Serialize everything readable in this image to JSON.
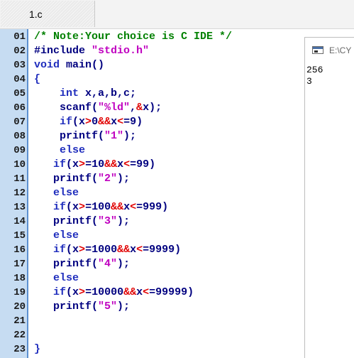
{
  "tabs": [
    {
      "label": "1.c"
    }
  ],
  "editor": {
    "lines": [
      {
        "n": "01",
        "tokens": [
          {
            "t": "/* Note:Your choice is C IDE */",
            "c": "comment"
          }
        ]
      },
      {
        "n": "02",
        "tokens": [
          {
            "t": "#include ",
            "c": "pre"
          },
          {
            "t": "\"stdio.h\"",
            "c": "str"
          }
        ]
      },
      {
        "n": "03",
        "tokens": [
          {
            "t": "void",
            "c": "kw"
          },
          {
            "t": " main()",
            "c": "plain"
          }
        ]
      },
      {
        "n": "04",
        "tokens": [
          {
            "t": "{",
            "c": "brace"
          }
        ]
      },
      {
        "n": "05",
        "tokens": [
          {
            "t": "    ",
            "c": "plain"
          },
          {
            "t": "int",
            "c": "kw"
          },
          {
            "t": " x,a,b,c;",
            "c": "plain"
          }
        ]
      },
      {
        "n": "06",
        "tokens": [
          {
            "t": "    scanf(",
            "c": "plain"
          },
          {
            "t": "\"%ld\"",
            "c": "str"
          },
          {
            "t": ",",
            "c": "plain"
          },
          {
            "t": "&",
            "c": "op"
          },
          {
            "t": "x);",
            "c": "plain"
          }
        ]
      },
      {
        "n": "07",
        "tokens": [
          {
            "t": "    ",
            "c": "plain"
          },
          {
            "t": "if",
            "c": "kw"
          },
          {
            "t": "(x",
            "c": "plain"
          },
          {
            "t": ">",
            "c": "op"
          },
          {
            "t": "0",
            "c": "plain"
          },
          {
            "t": "&&",
            "c": "op"
          },
          {
            "t": "x",
            "c": "plain"
          },
          {
            "t": "<",
            "c": "op"
          },
          {
            "t": "=9)",
            "c": "plain"
          }
        ]
      },
      {
        "n": "08",
        "tokens": [
          {
            "t": "    printf(",
            "c": "plain"
          },
          {
            "t": "\"1\"",
            "c": "str"
          },
          {
            "t": ");",
            "c": "plain"
          }
        ]
      },
      {
        "n": "09",
        "tokens": [
          {
            "t": "    ",
            "c": "plain"
          },
          {
            "t": "else",
            "c": "kw"
          }
        ]
      },
      {
        "n": "10",
        "tokens": [
          {
            "t": "   ",
            "c": "plain"
          },
          {
            "t": "if",
            "c": "kw"
          },
          {
            "t": "(x",
            "c": "plain"
          },
          {
            "t": ">",
            "c": "op"
          },
          {
            "t": "=10",
            "c": "plain"
          },
          {
            "t": "&&",
            "c": "op"
          },
          {
            "t": "x",
            "c": "plain"
          },
          {
            "t": "<",
            "c": "op"
          },
          {
            "t": "=99)",
            "c": "plain"
          }
        ]
      },
      {
        "n": "11",
        "tokens": [
          {
            "t": "   printf(",
            "c": "plain"
          },
          {
            "t": "\"2\"",
            "c": "str"
          },
          {
            "t": ");",
            "c": "plain"
          }
        ]
      },
      {
        "n": "12",
        "tokens": [
          {
            "t": "   ",
            "c": "plain"
          },
          {
            "t": "else",
            "c": "kw"
          }
        ]
      },
      {
        "n": "13",
        "tokens": [
          {
            "t": "   ",
            "c": "plain"
          },
          {
            "t": "if",
            "c": "kw"
          },
          {
            "t": "(x",
            "c": "plain"
          },
          {
            "t": ">",
            "c": "op"
          },
          {
            "t": "=100",
            "c": "plain"
          },
          {
            "t": "&&",
            "c": "op"
          },
          {
            "t": "x",
            "c": "plain"
          },
          {
            "t": "<",
            "c": "op"
          },
          {
            "t": "=999)",
            "c": "plain"
          }
        ]
      },
      {
        "n": "14",
        "tokens": [
          {
            "t": "   printf(",
            "c": "plain"
          },
          {
            "t": "\"3\"",
            "c": "str"
          },
          {
            "t": ");",
            "c": "plain"
          }
        ]
      },
      {
        "n": "15",
        "tokens": [
          {
            "t": "   ",
            "c": "plain"
          },
          {
            "t": "else",
            "c": "kw"
          }
        ]
      },
      {
        "n": "16",
        "tokens": [
          {
            "t": "   ",
            "c": "plain"
          },
          {
            "t": "if",
            "c": "kw"
          },
          {
            "t": "(x",
            "c": "plain"
          },
          {
            "t": ">",
            "c": "op"
          },
          {
            "t": "=1000",
            "c": "plain"
          },
          {
            "t": "&&",
            "c": "op"
          },
          {
            "t": "x",
            "c": "plain"
          },
          {
            "t": "<",
            "c": "op"
          },
          {
            "t": "=9999)",
            "c": "plain"
          }
        ]
      },
      {
        "n": "17",
        "tokens": [
          {
            "t": "   printf(",
            "c": "plain"
          },
          {
            "t": "\"4\"",
            "c": "str"
          },
          {
            "t": ");",
            "c": "plain"
          }
        ]
      },
      {
        "n": "18",
        "tokens": [
          {
            "t": "   ",
            "c": "plain"
          },
          {
            "t": "else",
            "c": "kw"
          }
        ]
      },
      {
        "n": "19",
        "tokens": [
          {
            "t": "   ",
            "c": "plain"
          },
          {
            "t": "if",
            "c": "kw"
          },
          {
            "t": "(x",
            "c": "plain"
          },
          {
            "t": ">",
            "c": "op"
          },
          {
            "t": "=10000",
            "c": "plain"
          },
          {
            "t": "&&",
            "c": "op"
          },
          {
            "t": "x",
            "c": "plain"
          },
          {
            "t": "<",
            "c": "op"
          },
          {
            "t": "=99999)",
            "c": "plain"
          }
        ]
      },
      {
        "n": "20",
        "tokens": [
          {
            "t": "   printf(",
            "c": "plain"
          },
          {
            "t": "\"5\"",
            "c": "str"
          },
          {
            "t": ");",
            "c": "plain"
          }
        ]
      },
      {
        "n": "21",
        "tokens": []
      },
      {
        "n": "22",
        "tokens": []
      },
      {
        "n": "23",
        "tokens": [
          {
            "t": "}",
            "c": "brace"
          }
        ]
      }
    ]
  },
  "console": {
    "title": "E:\\CY",
    "output": [
      "256",
      "3"
    ]
  },
  "colors": {
    "gutter": "#c6dcf2",
    "gutter_border": "#5b8fd0",
    "comment": "#008000",
    "keyword": "#1f2dbd",
    "string": "#c000c0",
    "operator": "#e00000",
    "identifier": "#000080"
  },
  "icons": {
    "console_window": "console-window-icon"
  }
}
